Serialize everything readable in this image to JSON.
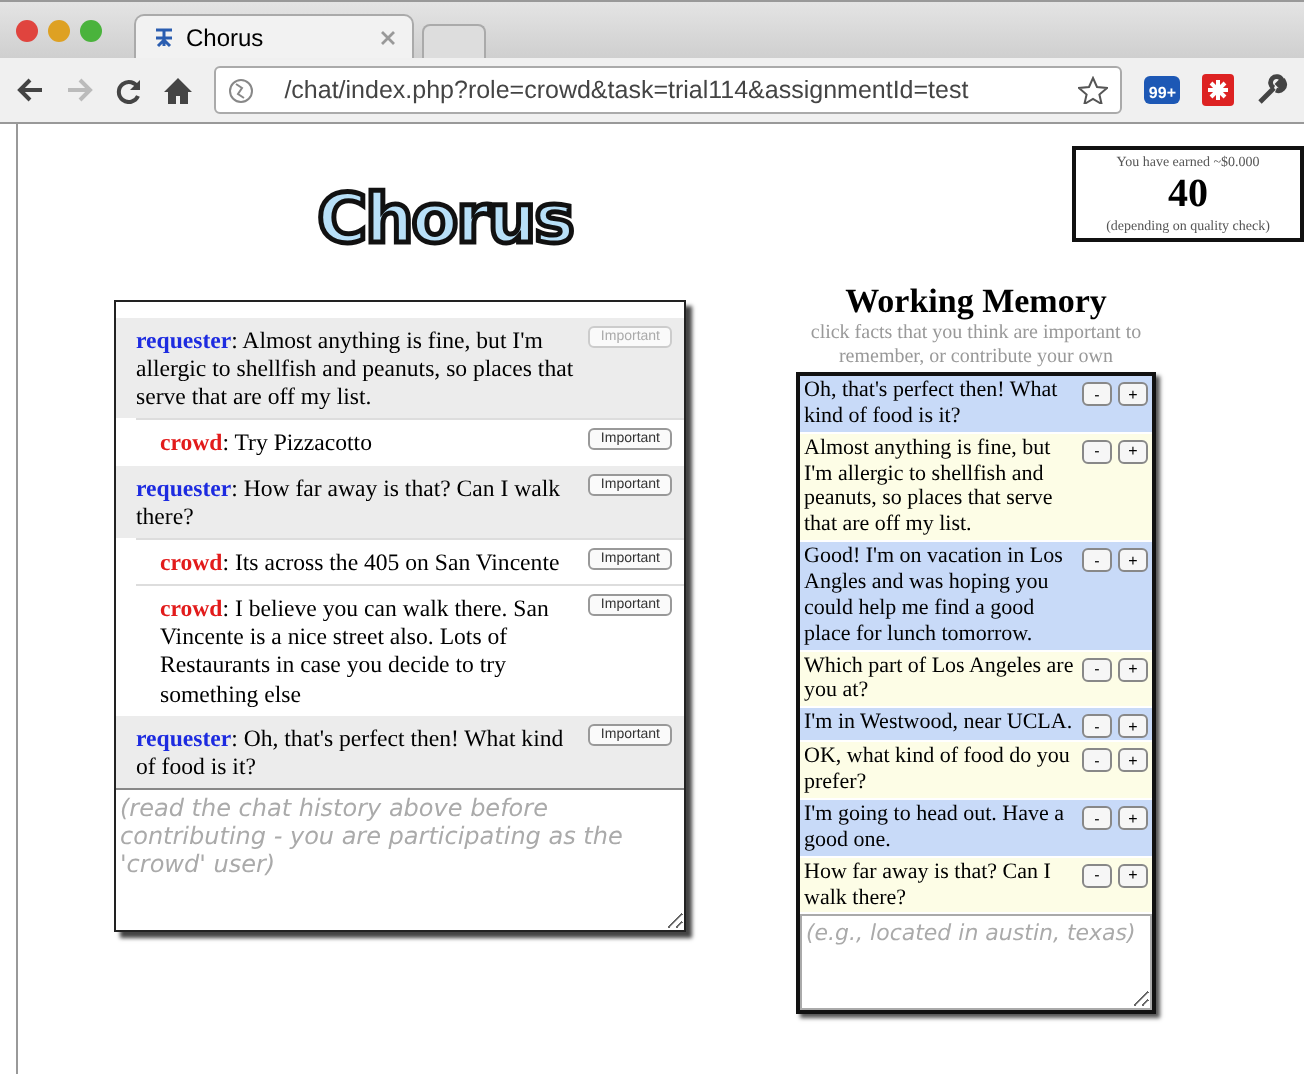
{
  "browser": {
    "tab_title": "Chorus",
    "url": "/chat/index.php?role=crowd&task=trial114&assignmentId=test",
    "badge": "99+"
  },
  "logo": "Chorus",
  "earnings": {
    "caption": "You have earned ~$0.000",
    "amount": "40",
    "note": "(depending on quality check)"
  },
  "chat": {
    "messages": [
      {
        "kind": "requester",
        "speaker": "requester",
        "text": ": Almost anything is fine, but I'm allergic to shellfish and peanuts, so places that serve that are off my list.",
        "button": "Important",
        "disabled": true
      },
      {
        "kind": "crowd",
        "speaker": "crowd",
        "text": ": Try Pizzacotto",
        "button": "Important",
        "disabled": false
      },
      {
        "kind": "requester",
        "speaker": "requester",
        "text": ": How far away is that? Can I walk there?",
        "button": "Important",
        "disabled": false
      },
      {
        "kind": "crowd",
        "speaker": "crowd",
        "text": ": Its across the 405 on San Vincente",
        "button": "Important",
        "disabled": false
      },
      {
        "kind": "crowd",
        "speaker": "crowd",
        "text": ": I believe you can walk there. San Vincente is a nice street also. Lots of Restaurants in case you decide to try something else",
        "button": "Important",
        "disabled": false
      },
      {
        "kind": "requester",
        "speaker": "requester",
        "text": ": Oh, that's perfect then! What kind of food is it?",
        "button": "Important",
        "disabled": false
      }
    ],
    "input_placeholder": "(read the chat history above before contributing - you are participating as the 'crowd' user)"
  },
  "memory": {
    "title": "Working Memory",
    "hint": "click facts that you think are important to remember, or contribute your own",
    "facts": [
      {
        "text": "Oh, that's perfect then! What kind of food is it?",
        "color": "#c8daf8",
        "minus": "-",
        "plus": "+"
      },
      {
        "text": "Almost anything is fine, but I'm allergic to shellfish and peanuts, so places that serve that are off my list.",
        "color": "#fdfde6",
        "minus": "-",
        "plus": "+"
      },
      {
        "text": "Good! I'm on vacation in Los Angles and was hoping you could help me find a good place for lunch tomorrow.",
        "color": "#c8daf8",
        "minus": "-",
        "plus": "+"
      },
      {
        "text": "Which part of Los Angeles are you at?",
        "color": "#fdfde6",
        "minus": "-",
        "plus": "+"
      },
      {
        "text": "I'm in Westwood, near UCLA.",
        "color": "#c8daf8",
        "minus": "-",
        "plus": "+"
      },
      {
        "text": "OK, what kind of food do you prefer?",
        "color": "#fdfde6",
        "minus": "-",
        "plus": "+"
      },
      {
        "text": "I'm going to head out. Have a good one.",
        "color": "#c8daf8",
        "minus": "-",
        "plus": "+"
      },
      {
        "text": "How far away is that? Can I walk there?",
        "color": "#fdfde6",
        "minus": "-",
        "plus": "+"
      }
    ],
    "input_placeholder": "(e.g., located in austin, texas)"
  }
}
